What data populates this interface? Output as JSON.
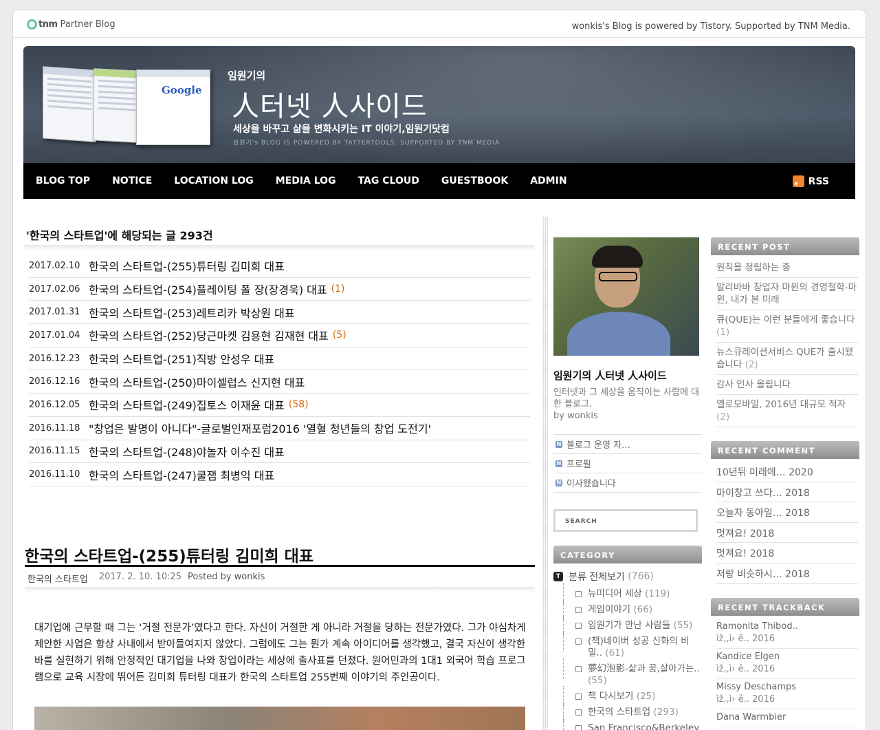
{
  "topbar": {
    "logo_tnm": "tnm",
    "logo_text": "Partner Blog",
    "powered": "wonkis's Blog is powered by Tistory. Supported by TNM Media."
  },
  "header": {
    "owner": "임원기의",
    "title": "人터넷 人사이드",
    "description": "세상을 바꾸고 삶을 변화시키는 IT 이야기,임원기닷컴",
    "powered": "임원기's BLOG IS POWERED BY TATTERTOOLS. SUPPORTED BY TNM MEDIA",
    "google_word": "Google"
  },
  "nav": {
    "items": [
      "BLOG TOP",
      "NOTICE",
      "LOCATION LOG",
      "MEDIA LOG",
      "TAG CLOUD",
      "GUESTBOOK",
      "ADMIN"
    ],
    "rss": "RSS"
  },
  "list": {
    "title": "'한국의 스타트업'에 해당되는 글 293건",
    "posts": [
      {
        "date": "2017.02.10",
        "title": "한국의 스타트업-(255)튜터링 김미희 대표",
        "count": ""
      },
      {
        "date": "2017.02.06",
        "title": "한국의 스타트업-(254)플레이팅 폴 장(장경욱) 대표",
        "count": "(1)"
      },
      {
        "date": "2017.01.31",
        "title": "한국의 스타트업-(253)레트리카 박상원 대표",
        "count": ""
      },
      {
        "date": "2017.01.04",
        "title": "한국의 스타트업-(252)당근마켓 김용현 김재현 대표",
        "count": "(5)"
      },
      {
        "date": "2016.12.23",
        "title": "한국의 스타트업-(251)직방 안성우 대표",
        "count": ""
      },
      {
        "date": "2016.12.16",
        "title": "한국의 스타트업-(250)마이셀럽스 신지현 대표",
        "count": ""
      },
      {
        "date": "2016.12.05",
        "title": "한국의 스타트업-(249)집토스 이재윤 대표",
        "count": "(58)"
      },
      {
        "date": "2016.11.18",
        "title": "\"창업은 발명이 아니다\"-글로벌인재포럼2016 '열혈 청년들의 창업 도전기'",
        "count": ""
      },
      {
        "date": "2016.11.15",
        "title": "한국의 스타트업-(248)야놀자 이수진 대표",
        "count": ""
      },
      {
        "date": "2016.11.10",
        "title": "한국의 스타트업-(247)쿨잼 최병익 대표",
        "count": ""
      }
    ]
  },
  "article": {
    "title": "한국의 스타트업-(255)튜터링 김미희 대표",
    "category": "한국의 스타트업",
    "date": "2017. 2. 10. 10:25",
    "posted_by": "Posted by wonkis",
    "body": "대기업에 근무할 때 그는 ‘거절 전문가’였다고 한다. 자신이 거절한 게 아니라 거절을 당하는 전문가였다. 그가 야심차게 제안한 사업은 항상 사내에서 받아들여지지 않았다. 그럼에도 그는 뭔가 계속 아이디어를 생각했고, 결국 자신이 생각한 바를 실현하기 위해 안정적인 대기업을 나와 창업이라는 세상에 출사표를 던졌다. 원어민과의 1대1 외국어 학습 프로그램으로 교육 시장에 뛰어든 김미희 튜터링 대표가 한국의 스타트업 255번째 이야기의 주인공이다."
  },
  "profile": {
    "name": "임원기의 人터넷 人사이드",
    "description": "인터넷과 그 세상을 움직이는 사람에 대한 블로그.",
    "by": "by wonkis",
    "links": [
      "블로그 운영 자…",
      "프로필",
      "이사했습니다"
    ],
    "link_icon": "N"
  },
  "search": {
    "placeholder": "SEARCH"
  },
  "category": {
    "head": "CATEGORY",
    "root_icon": "T",
    "root": {
      "name": "분류 전체보기",
      "count": "(766)"
    },
    "items": [
      {
        "name": "뉴미디어 세상",
        "count": "(119)"
      },
      {
        "name": "게임이야기",
        "count": "(66)"
      },
      {
        "name": "임원기가 만난 사람들",
        "count": "(55)"
      },
      {
        "name": "(책)네이버 성공 신화의 비밀..",
        "count": "(61)"
      },
      {
        "name": "夢幻泡影-삶과 꿈,살아가는..",
        "count": "(55)"
      },
      {
        "name": "책 다시보기",
        "count": "(25)"
      },
      {
        "name": "한국의 스타트업",
        "count": "(293)"
      },
      {
        "name": "San Francisco&Berkeley",
        "count": ""
      }
    ]
  },
  "recent_post": {
    "head": "RECENT POST",
    "items": [
      {
        "title": "원칙을 정립하는 중",
        "count": ""
      },
      {
        "title": "알리바바 창업자 마윈의 경영철학-마윈, 내가 본 미래",
        "count": ""
      },
      {
        "title": "큐(QUE)는 이런 분들에게 좋습니다",
        "count": "(1)"
      },
      {
        "title": "뉴스큐레이션서비스 QUE가 출시됐습니다",
        "count": "(2)"
      },
      {
        "title": "감사 인사 올립니다",
        "count": ""
      },
      {
        "title": "옐로모바일, 2016년 대규모 적자",
        "count": "(2)"
      }
    ]
  },
  "recent_comment": {
    "head": "RECENT COMMENT",
    "items": [
      "10년뒤 미래에… 2020",
      "마이창고 쓰다… 2018",
      "오늘자 동아일… 2018",
      "멋져요! 2018",
      "멋져요! 2018",
      "저랑 비슷하시… 2018"
    ]
  },
  "recent_trackback": {
    "head": "RECENT TRACKBACK",
    "items": [
      {
        "name": "Ramonita Thibod..",
        "sub": "ìž,,ì›    ê.. 2016"
      },
      {
        "name": "Kandice Elgen",
        "sub": "ìž,,ì›    ê.. 2016"
      },
      {
        "name": "Missy Deschamps",
        "sub": "ìž,,ì›    ê.. 2016"
      },
      {
        "name": "Dana Warmbier",
        "sub": ""
      }
    ]
  }
}
